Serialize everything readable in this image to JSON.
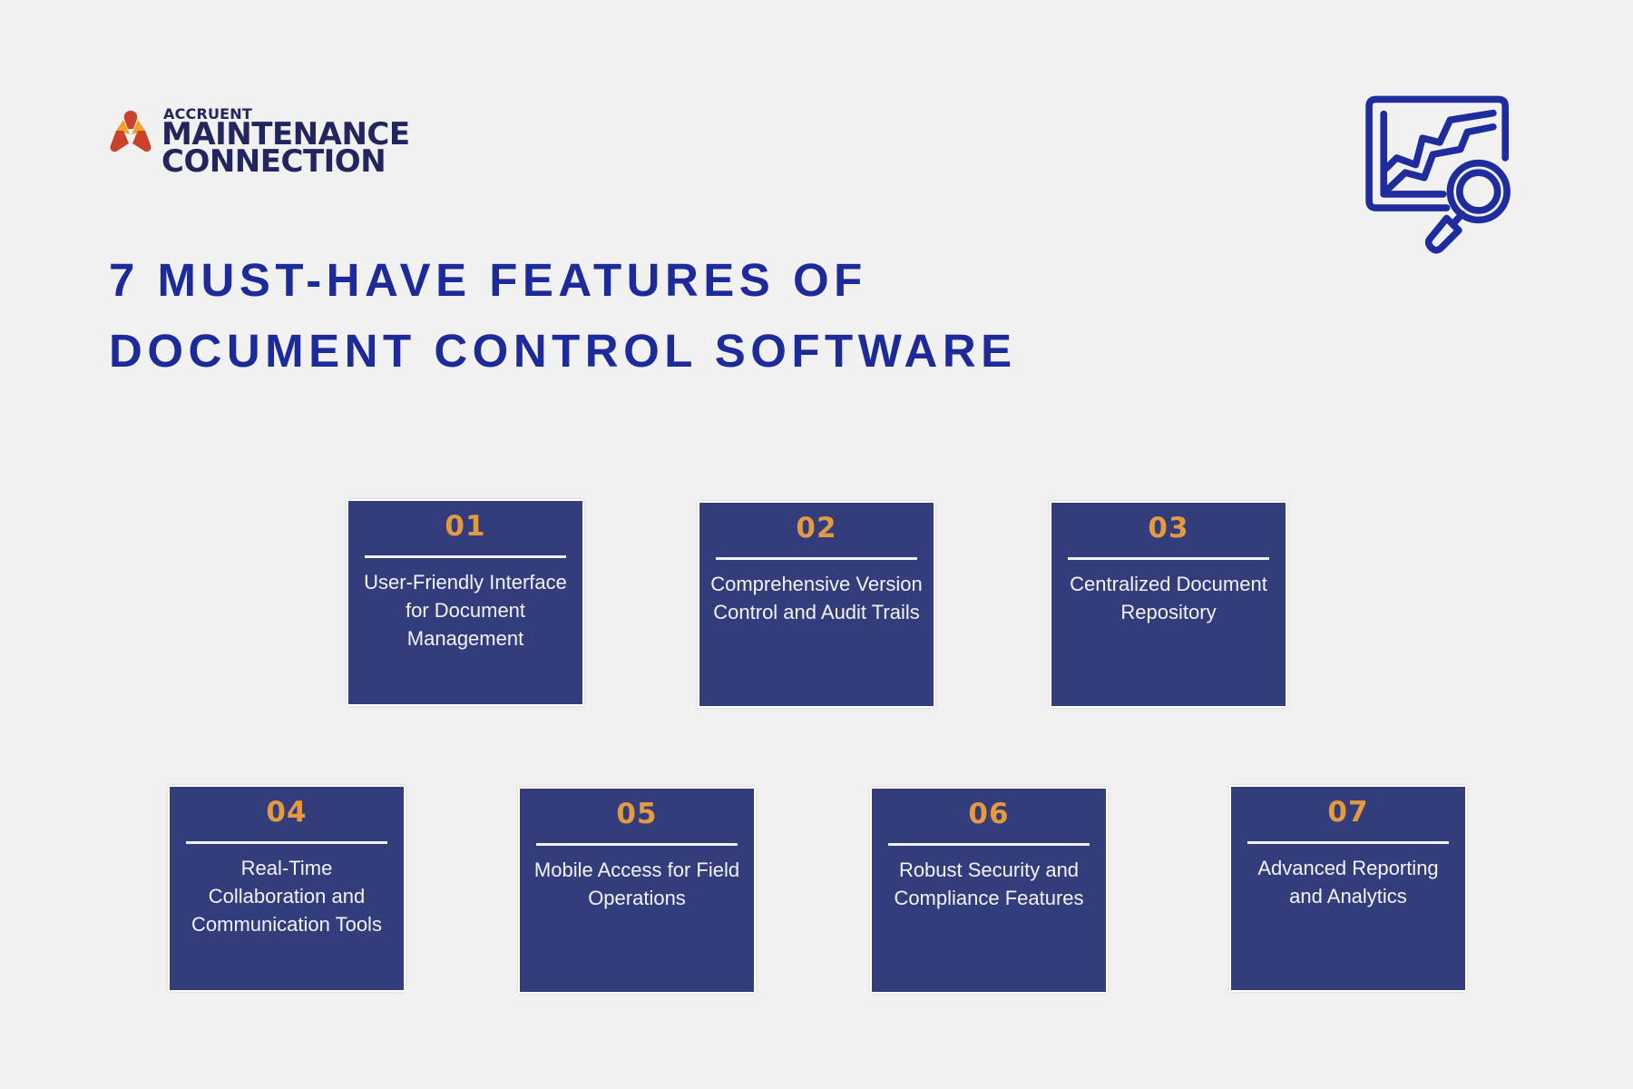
{
  "brand": {
    "small": "ACCRUENT",
    "line1": "MAINTENANCE",
    "line2": "CONNECTION",
    "colors": {
      "navy": "#23265e",
      "orange": "#f0a32c",
      "red": "#c9432b"
    }
  },
  "header": {
    "title_line1": "7 MUST-HAVE FEATURES OF",
    "title_line2": "DOCUMENT CONTROL SOFTWARE",
    "icon": "chart-magnifier-icon",
    "title_color": "#1d2a9a"
  },
  "features": [
    {
      "number": "01",
      "text": "User-Friendly Interface for Document Management"
    },
    {
      "number": "02",
      "text": "Comprehensive Version Control and Audit Trails"
    },
    {
      "number": "03",
      "text": "Centralized Document Repository"
    },
    {
      "number": "04",
      "text": "Real-Time Collaboration and Communication Tools"
    },
    {
      "number": "05",
      "text": "Mobile Access for Field Operations"
    },
    {
      "number": "06",
      "text": "Robust Security and Compliance Features"
    },
    {
      "number": "07",
      "text": "Advanced Reporting and Analytics"
    }
  ],
  "colors": {
    "card_bg": "#333d7c",
    "number": "#e69a40",
    "background": "#f1f1f1"
  }
}
